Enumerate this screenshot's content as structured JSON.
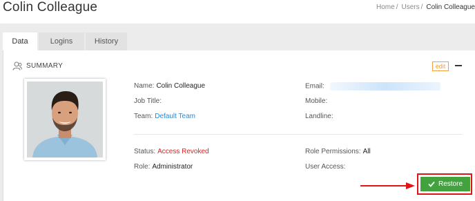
{
  "header": {
    "title": "Colin Colleague",
    "breadcrumb": [
      "Home",
      "Users",
      "Colin Colleague"
    ]
  },
  "tabs": [
    {
      "label": "Data",
      "active": true
    },
    {
      "label": "Logins",
      "active": false
    },
    {
      "label": "History",
      "active": false
    }
  ],
  "summary": {
    "section_label": "SUMMARY",
    "edit_label": "edit",
    "icon": "user-icon",
    "photo_icon": "user-photo",
    "fields": {
      "name_label": "Name:",
      "name_value": "Colin Colleague",
      "job_label": "Job Title:",
      "team_label": "Team:",
      "team_value": "Default Team",
      "email_label": "Email:",
      "mobile_label": "Mobile:",
      "landline_label": "Landline:",
      "status_label": "Status:",
      "status_value": "Access Revoked",
      "role_label": "Role:",
      "role_value": "Administrator",
      "role_permissions_label": "Role Permissions:",
      "role_permissions_value": "All",
      "user_access_label": "User Access:"
    }
  },
  "actions": {
    "restore_label": "Restore",
    "restore_icon": "check-icon"
  },
  "colors": {
    "accent_link": "#2b8ad0",
    "revoked": "#e02020",
    "restore_button": "#42a33e",
    "highlight_border": "#e01414",
    "edit_border": "#f0a040"
  }
}
